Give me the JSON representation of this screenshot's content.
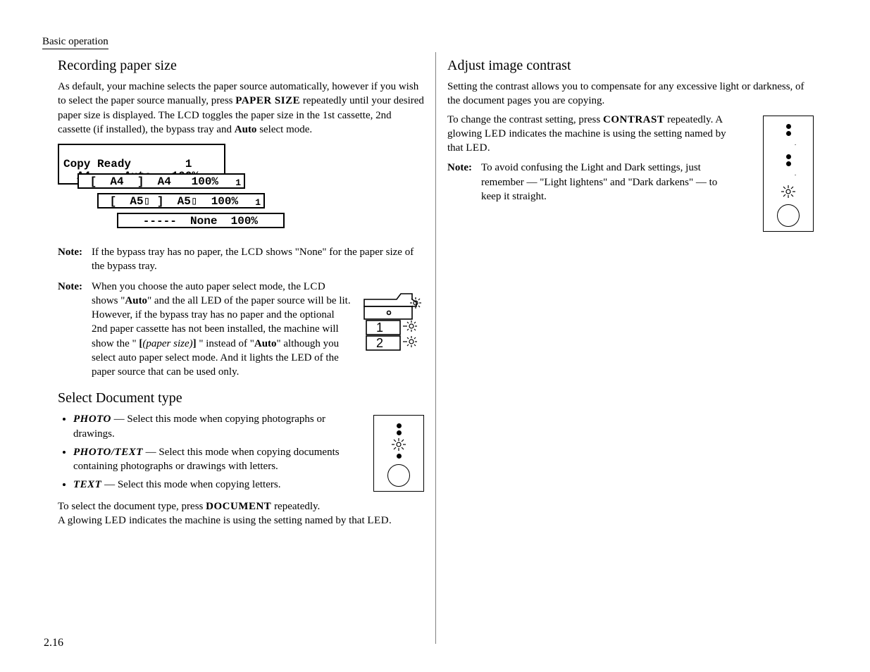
{
  "running_head": "Basic operation",
  "page_number": "2.16",
  "left": {
    "h_paper": "Recording paper size",
    "p_paper_1a": "As default, your machine selects the paper source automatically, however if you wish to select the paper source manually, press ",
    "paper_size_sc": "PAPER SIZE",
    "p_paper_1b": " repeatedly until your desired paper size is displayed. The ",
    "lcd_sc": "LCD",
    "p_paper_1c": " toggles the paper size in the 1st cassette, 2nd cassette (if installed), the bypass tray and ",
    "auto_b": "Auto",
    "p_paper_1d": " select mode.",
    "lcd": {
      "r0a": "Copy Ready        1",
      "r0b": "  A4     Auto   100%",
      "tag0": "1",
      "r1": " [  A4  ]  A4   100%",
      "tag1": "1",
      "r2": " [  A5▯ ]  A5▯  100%",
      "tag2": "1",
      "r3": "   -----  None  100%"
    },
    "note1_label": "Note:",
    "note1_a": "If the bypass tray has no paper, the ",
    "note1_b": " shows \"None\" for the paper size of the bypass tray.",
    "note2_label": "Note:",
    "note2_a": "When you choose the auto paper select mode, the ",
    "note2_b": " shows \"",
    "note2_auto": "Auto",
    "note2_c": "\" and the all LED of the paper source will be lit.",
    "note2_d": "However, if the bypass tray has no paper and the optional 2nd paper cassette has not been installed, the machine will show the \" ",
    "note2_brL": "[",
    "note2_ps": "(paper size)",
    "note2_brR": "]",
    "note2_e": " \" instead of \"",
    "note2_f": "\" although you select auto paper select mode. And it lights the LED of the paper source that can be used only.",
    "h_doc": "Select Document type",
    "li_photo_sc": "PHOTO",
    "li_photo_t": " — Select this mode when copying photographs or drawings.",
    "li_pt_sc": "PHOTO/TEXT",
    "li_pt_t": " — Select this mode when copying documents containing photographs or drawings with letters.",
    "li_text_sc": "TEXT",
    "li_text_t": " — Select this mode when copying letters.",
    "doc_p2a": "To select the document type, press ",
    "document_sc": "DOCUMENT",
    "doc_p2b": " repeatedly.",
    "doc_p3a": "A glowing ",
    "led_sc": "LED",
    "doc_p3b": " indicates the machine is using the setting named by that ",
    "doc_p3c": "."
  },
  "right": {
    "h_contrast": "Adjust image contrast",
    "p1": "Setting the contrast allows you to compensate for any excessive light or darkness, of the document pages you are copying.",
    "p2a": "To change the contrast setting, press ",
    "contrast_sc": "CONTRAST",
    "p2b": " repeatedly. A glowing ",
    "p2c": " indicates the machine is using the setting named by that ",
    "p2d": ".",
    "note_label": "Note:",
    "note_a": "To avoid confusing the Light and Dark settings, just remember — \"Light lightens\" and \"Dark darkens\" — to keep it straight."
  },
  "printer_labels": {
    "one": "1",
    "two": "2"
  }
}
